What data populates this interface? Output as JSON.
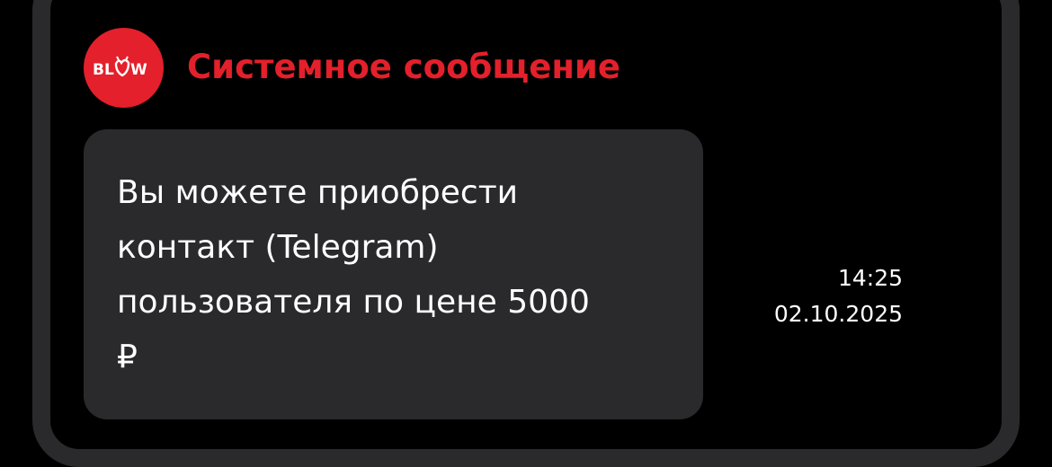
{
  "message": {
    "avatar_logo": "BLOW",
    "sender_name": "Системное сообщение",
    "text": "Вы можете приобрести\nконтакт (Telegram)\nпользователя по цене 5000\n₽",
    "time": "14:25",
    "date": "02.10.2025"
  },
  "colors": {
    "background": "#000000",
    "frame": "#2a2a2c",
    "accent": "#e3202b",
    "bubble": "#2a2a2c",
    "text": "#ffffff"
  },
  "icons": {
    "avatar": "blow-logo-icon"
  }
}
